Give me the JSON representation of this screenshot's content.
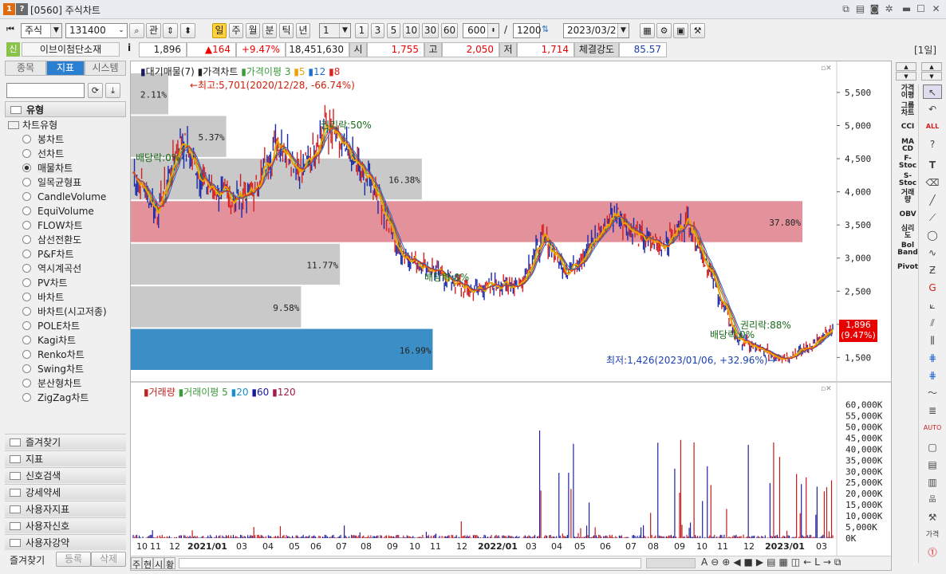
{
  "window": {
    "code": "[0560]",
    "title": "주식차트",
    "badge1": "1",
    "badge2": "?"
  },
  "toolbar": {
    "market": "주식",
    "code": "131400",
    "btn_gwan": "관",
    "periods": [
      "일",
      "주",
      "월",
      "분",
      "틱",
      "년"
    ],
    "active_period": "일",
    "interval_select": "1",
    "intervals": [
      "1",
      "3",
      "5",
      "10",
      "30",
      "60"
    ],
    "count": "600",
    "total": "1200",
    "date": "2023/03/21"
  },
  "quote": {
    "tag": "신",
    "name": "이브이첨단소재",
    "info": "i",
    "price": "1,896",
    "change": "▲164",
    "change_pct": "+9.47%",
    "volume": "18,451,630",
    "open_label": "시",
    "open": "1,755",
    "high_label": "고",
    "high": "2,050",
    "low_label": "저",
    "low": "1,714",
    "strength_label": "체결강도",
    "strength": "85.57",
    "span": "[1일]"
  },
  "left_panel": {
    "tabs": [
      "종목",
      "지표",
      "시스템"
    ],
    "active_tab": "지표",
    "section": "유형",
    "tree_root": "차트유형",
    "chart_types": [
      "봉차트",
      "선차트",
      "매물차트",
      "일목균형표",
      "CandleVolume",
      "EquiVolume",
      "FLOW차트",
      "삼선전환도",
      "P&F차트",
      "역시계곡선",
      "PV차트",
      "바차트",
      "바차트(시고저종)",
      "POLE차트",
      "Kagi차트",
      "Renko차트",
      "Swing차트",
      "분산형차트",
      "ZigZag차트"
    ],
    "selected_type": "매물차트",
    "groups": [
      "즐겨찾기",
      "지표",
      "신호검색",
      "강세약세",
      "사용자지표",
      "사용자신호",
      "사용자강약"
    ],
    "bottom_tabs": [
      "즐겨찾기",
      "등록",
      "삭제"
    ]
  },
  "price_pane": {
    "legend": {
      "vp": "대기매물(7)",
      "price": "가격차트",
      "ma_label": "가격이평",
      "ma": [
        "3",
        "5",
        "12",
        "8"
      ],
      "ma_colors": [
        "#3a9a3a",
        "#f0a000",
        "#1a6fd0",
        "#e02020"
      ]
    },
    "max_label": "←최고:5,701(2020/12/28, -66.74%)",
    "min_label": "최저:1,426(2023/01/06, +32.96%)→",
    "events": [
      "배당락:0%",
      "권리락:50%",
      "배당락:0%",
      "권리락:88%",
      "배당락:0%"
    ],
    "yaxis": [
      "5,500",
      "5,000",
      "4,500",
      "4,000",
      "3,500",
      "3,000",
      "2,500",
      "2,000",
      "1,500"
    ],
    "price_tag": "1,896",
    "pct_tag": "(9.47%)"
  },
  "volume_profile": [
    {
      "label": "2.11%",
      "pct": 2.11,
      "highlight": "none"
    },
    {
      "label": "5.37%",
      "pct": 5.37,
      "highlight": "none"
    },
    {
      "label": "16.38%",
      "pct": 16.38,
      "highlight": "none"
    },
    {
      "label": "37.80%",
      "pct": 37.8,
      "highlight": "max"
    },
    {
      "label": "11.77%",
      "pct": 11.77,
      "highlight": "none"
    },
    {
      "label": "9.58%",
      "pct": 9.58,
      "highlight": "none"
    },
    {
      "label": "16.99%",
      "pct": 16.99,
      "highlight": "current"
    }
  ],
  "volume_pane": {
    "legend": {
      "vol": "거래량",
      "ma_label": "거래이평",
      "ma": [
        "5",
        "20",
        "60",
        "120"
      ],
      "ma_colors": [
        "#3a9a3a",
        "#1a8fd0",
        "#1a1aa0",
        "#a01a4a"
      ]
    },
    "yaxis": [
      "60,000K",
      "55,000K",
      "50,000K",
      "45,000K",
      "40,000K",
      "35,000K",
      "30,000K",
      "25,000K",
      "20,000K",
      "15,000K",
      "10,000K",
      "5,000K",
      "0K"
    ]
  },
  "xaxis": [
    "10",
    "11",
    "12",
    "2021/01",
    "03",
    "04",
    "05",
    "06",
    "07",
    "08",
    "09",
    "10",
    "11",
    "12",
    "2022/01",
    "03",
    "04",
    "05",
    "06",
    "07",
    "08",
    "09",
    "10",
    "11",
    "12",
    "2023/01",
    "03"
  ],
  "bottom_left": [
    "주",
    "현",
    "시",
    "황"
  ],
  "chart_data": {
    "type": "line",
    "title": "가격차트",
    "ylim": [
      1300,
      5800
    ],
    "x": [
      "2020-10",
      "2020-11",
      "2020-12",
      "2021-01",
      "2021-02",
      "2021-03",
      "2021-04",
      "2021-05",
      "2021-06",
      "2021-07",
      "2021-08",
      "2021-09",
      "2021-10",
      "2021-11",
      "2021-12",
      "2022-01",
      "2022-02",
      "2022-03",
      "2022-04",
      "2022-05",
      "2022-06",
      "2022-07",
      "2022-08",
      "2022-09",
      "2022-10",
      "2022-11",
      "2022-12",
      "2023-01",
      "2023-02",
      "2023-03"
    ],
    "series": [
      {
        "name": "가격차트",
        "values": [
          4300,
          3700,
          4800,
          4100,
          3900,
          4000,
          4800,
          4300,
          5000,
          4500,
          4100,
          3100,
          2900,
          2700,
          2500,
          2600,
          2600,
          3300,
          2800,
          3200,
          3700,
          3300,
          3200,
          3600,
          2700,
          1800,
          1600,
          1500,
          1650,
          1896
        ]
      }
    ],
    "ma_visible": [
      "3",
      "5",
      "12",
      "8"
    ]
  }
}
